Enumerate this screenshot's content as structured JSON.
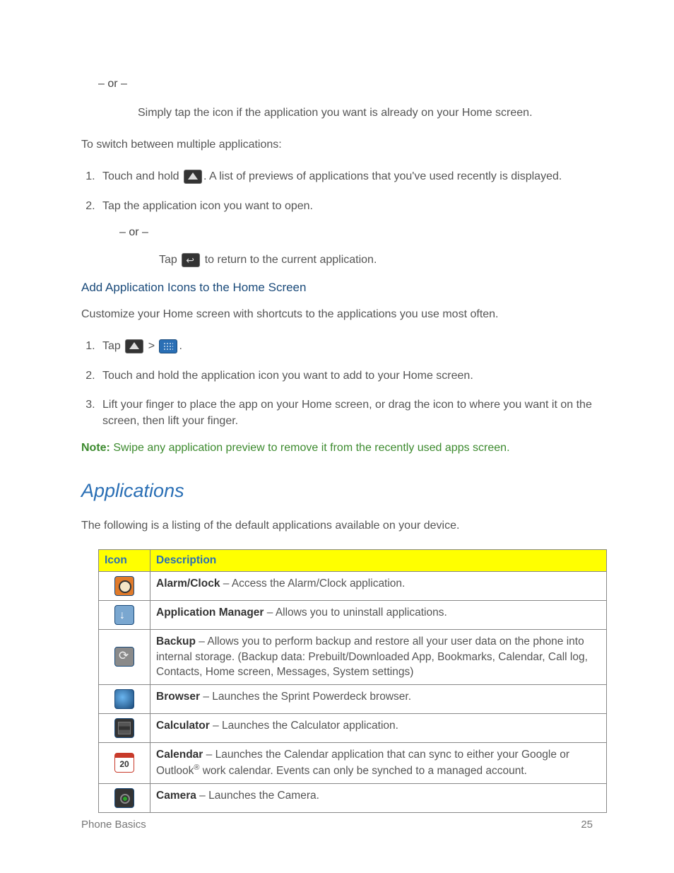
{
  "intro": {
    "or1": "– or –",
    "tap_icon": "Simply tap the icon if the application you want is already on your Home screen.",
    "switch_hdr": "To switch between multiple applications:",
    "step1a": "Touch and hold ",
    "step1b": ". A list of previews of applications that you've used recently is displayed.",
    "step2": "Tap the application icon you want to open.",
    "or2": "– or –",
    "tap_return_a": "Tap ",
    "tap_return_b": " to return to the current application."
  },
  "add_section": {
    "heading": "Add Application Icons to the Home Screen",
    "lead": "Customize your Home screen with shortcuts to the applications you use most often.",
    "s1a": "Tap ",
    "s1b": " > ",
    "s1c": ".",
    "s2": "Touch and hold the application icon you want to add to your Home screen.",
    "s3": "Lift your finger to place the app on your Home screen, or drag the icon to where you want it on the screen, then lift your finger.",
    "note_label": "Note:",
    "note_body": "  Swipe any application preview to remove it from the recently used apps screen."
  },
  "apps_section": {
    "title": "Applications",
    "lead": "The following is a listing of the default applications available on your device.",
    "th_icon": "Icon",
    "th_desc": "Description",
    "rows": [
      {
        "name": "Alarm/Clock",
        "desc": " – Access the Alarm/Clock application."
      },
      {
        "name": "Application Manager",
        "desc": " – Allows you to uninstall applications."
      },
      {
        "name": "Backup",
        "desc": " – Allows you to perform backup and restore all your user data on the phone into internal storage. (Backup data: Prebuilt/Downloaded App, Bookmarks, Calendar, Call log, Contacts, Home screen, Messages, System settings)"
      },
      {
        "name": "Browser",
        "desc": " – Launches the Sprint Powerdeck browser."
      },
      {
        "name": "Calculator",
        "desc": " – Launches the Calculator application."
      },
      {
        "name": "Calendar",
        "desc_a": " – Launches the Calendar application that can sync to either your Google or Outlook",
        "reg": "®",
        "desc_b": " work calendar. Events can only be synched to a managed account."
      },
      {
        "name": "Camera",
        "desc": " – Launches the Camera."
      }
    ]
  },
  "footer": {
    "left": "Phone Basics",
    "right": "25"
  }
}
